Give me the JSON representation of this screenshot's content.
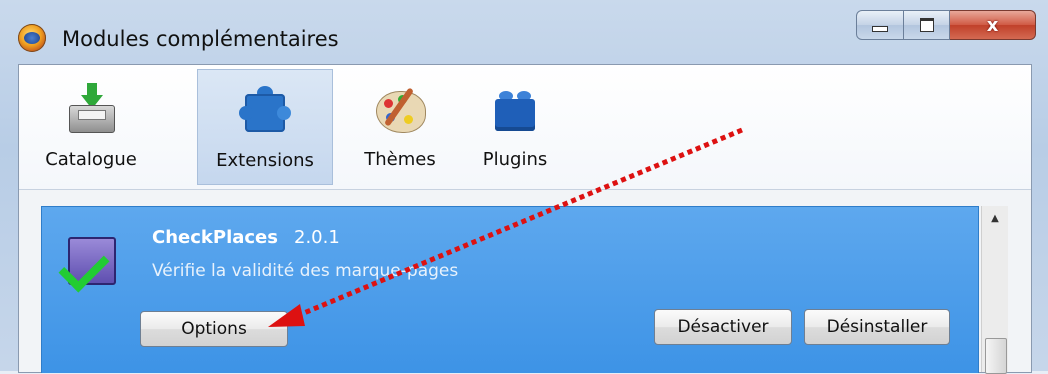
{
  "window": {
    "title": "Modules complémentaires",
    "minimize_glyph": "minimize",
    "maximize_glyph": "maximize",
    "close_glyph": "x"
  },
  "toolbar": {
    "items": [
      {
        "label": "Catalogue",
        "icon": "download-tray-icon",
        "active": false
      },
      {
        "label": "Extensions",
        "icon": "puzzle-piece-icon",
        "active": true
      },
      {
        "label": "Thèmes",
        "icon": "palette-icon",
        "active": false
      },
      {
        "label": "Plugins",
        "icon": "lego-brick-icon",
        "active": false
      }
    ]
  },
  "extension": {
    "name": "CheckPlaces",
    "version": "2.0.1",
    "description": "Vérifie la validité des marque-pages",
    "options_button": "Options",
    "disable_button": "Désactiver",
    "uninstall_button": "Désinstaller"
  },
  "colors": {
    "selection": "#3d93e6",
    "annotation_arrow": "#dd1111"
  }
}
